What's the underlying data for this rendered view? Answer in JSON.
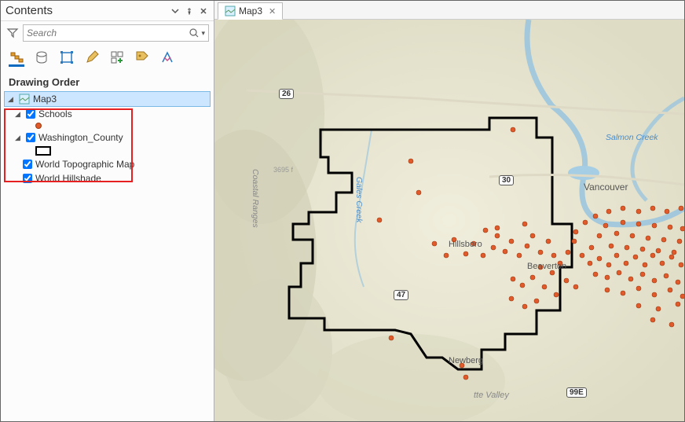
{
  "contents": {
    "title": "Contents",
    "search_placeholder": "Search",
    "section": "Drawing Order",
    "map_name": "Map3",
    "layers": [
      {
        "name": "Schools",
        "checked": true,
        "symbol": "point"
      },
      {
        "name": "Washington_County",
        "checked": true,
        "symbol": "rect"
      },
      {
        "name": "World Topographic Map",
        "checked": true,
        "symbol": null
      },
      {
        "name": "World Hillshade",
        "checked": true,
        "symbol": null
      }
    ]
  },
  "tabs": {
    "active": "Map3"
  },
  "map": {
    "cities": {
      "vancouver": "Vancouver",
      "hillsboro": "Hillsboro",
      "beaverton": "Beaverton",
      "newberg": "Newberg"
    },
    "water": {
      "salmon_creek": "Salmon Creek",
      "gales_creek": "Gales Creek"
    },
    "terrain": {
      "coastal_ranges": "Coastal Ranges",
      "valley": "tte Valley"
    },
    "routes": {
      "r26": "26",
      "r30": "30",
      "r47": "47",
      "r99e": "99E"
    },
    "elevation": "3695 f"
  }
}
